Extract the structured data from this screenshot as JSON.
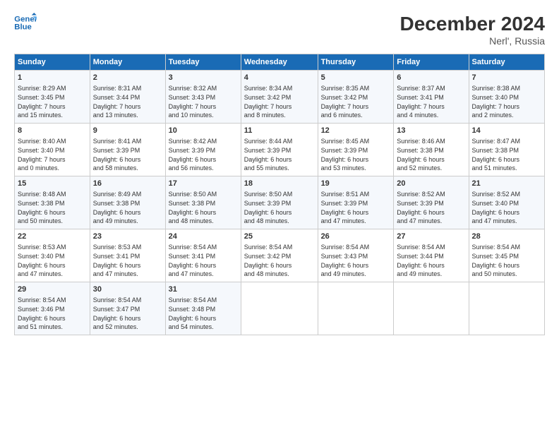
{
  "header": {
    "title": "December 2024",
    "subtitle": "Nerl', Russia",
    "logo_line1": "General",
    "logo_line2": "Blue"
  },
  "days_of_week": [
    "Sunday",
    "Monday",
    "Tuesday",
    "Wednesday",
    "Thursday",
    "Friday",
    "Saturday"
  ],
  "weeks": [
    [
      {
        "day": 1,
        "lines": [
          "Sunrise: 8:29 AM",
          "Sunset: 3:45 PM",
          "Daylight: 7 hours",
          "and 15 minutes."
        ]
      },
      {
        "day": 2,
        "lines": [
          "Sunrise: 8:31 AM",
          "Sunset: 3:44 PM",
          "Daylight: 7 hours",
          "and 13 minutes."
        ]
      },
      {
        "day": 3,
        "lines": [
          "Sunrise: 8:32 AM",
          "Sunset: 3:43 PM",
          "Daylight: 7 hours",
          "and 10 minutes."
        ]
      },
      {
        "day": 4,
        "lines": [
          "Sunrise: 8:34 AM",
          "Sunset: 3:42 PM",
          "Daylight: 7 hours",
          "and 8 minutes."
        ]
      },
      {
        "day": 5,
        "lines": [
          "Sunrise: 8:35 AM",
          "Sunset: 3:42 PM",
          "Daylight: 7 hours",
          "and 6 minutes."
        ]
      },
      {
        "day": 6,
        "lines": [
          "Sunrise: 8:37 AM",
          "Sunset: 3:41 PM",
          "Daylight: 7 hours",
          "and 4 minutes."
        ]
      },
      {
        "day": 7,
        "lines": [
          "Sunrise: 8:38 AM",
          "Sunset: 3:40 PM",
          "Daylight: 7 hours",
          "and 2 minutes."
        ]
      }
    ],
    [
      {
        "day": 8,
        "lines": [
          "Sunrise: 8:40 AM",
          "Sunset: 3:40 PM",
          "Daylight: 7 hours",
          "and 0 minutes."
        ]
      },
      {
        "day": 9,
        "lines": [
          "Sunrise: 8:41 AM",
          "Sunset: 3:39 PM",
          "Daylight: 6 hours",
          "and 58 minutes."
        ]
      },
      {
        "day": 10,
        "lines": [
          "Sunrise: 8:42 AM",
          "Sunset: 3:39 PM",
          "Daylight: 6 hours",
          "and 56 minutes."
        ]
      },
      {
        "day": 11,
        "lines": [
          "Sunrise: 8:44 AM",
          "Sunset: 3:39 PM",
          "Daylight: 6 hours",
          "and 55 minutes."
        ]
      },
      {
        "day": 12,
        "lines": [
          "Sunrise: 8:45 AM",
          "Sunset: 3:39 PM",
          "Daylight: 6 hours",
          "and 53 minutes."
        ]
      },
      {
        "day": 13,
        "lines": [
          "Sunrise: 8:46 AM",
          "Sunset: 3:38 PM",
          "Daylight: 6 hours",
          "and 52 minutes."
        ]
      },
      {
        "day": 14,
        "lines": [
          "Sunrise: 8:47 AM",
          "Sunset: 3:38 PM",
          "Daylight: 6 hours",
          "and 51 minutes."
        ]
      }
    ],
    [
      {
        "day": 15,
        "lines": [
          "Sunrise: 8:48 AM",
          "Sunset: 3:38 PM",
          "Daylight: 6 hours",
          "and 50 minutes."
        ]
      },
      {
        "day": 16,
        "lines": [
          "Sunrise: 8:49 AM",
          "Sunset: 3:38 PM",
          "Daylight: 6 hours",
          "and 49 minutes."
        ]
      },
      {
        "day": 17,
        "lines": [
          "Sunrise: 8:50 AM",
          "Sunset: 3:38 PM",
          "Daylight: 6 hours",
          "and 48 minutes."
        ]
      },
      {
        "day": 18,
        "lines": [
          "Sunrise: 8:50 AM",
          "Sunset: 3:39 PM",
          "Daylight: 6 hours",
          "and 48 minutes."
        ]
      },
      {
        "day": 19,
        "lines": [
          "Sunrise: 8:51 AM",
          "Sunset: 3:39 PM",
          "Daylight: 6 hours",
          "and 47 minutes."
        ]
      },
      {
        "day": 20,
        "lines": [
          "Sunrise: 8:52 AM",
          "Sunset: 3:39 PM",
          "Daylight: 6 hours",
          "and 47 minutes."
        ]
      },
      {
        "day": 21,
        "lines": [
          "Sunrise: 8:52 AM",
          "Sunset: 3:40 PM",
          "Daylight: 6 hours",
          "and 47 minutes."
        ]
      }
    ],
    [
      {
        "day": 22,
        "lines": [
          "Sunrise: 8:53 AM",
          "Sunset: 3:40 PM",
          "Daylight: 6 hours",
          "and 47 minutes."
        ]
      },
      {
        "day": 23,
        "lines": [
          "Sunrise: 8:53 AM",
          "Sunset: 3:41 PM",
          "Daylight: 6 hours",
          "and 47 minutes."
        ]
      },
      {
        "day": 24,
        "lines": [
          "Sunrise: 8:54 AM",
          "Sunset: 3:41 PM",
          "Daylight: 6 hours",
          "and 47 minutes."
        ]
      },
      {
        "day": 25,
        "lines": [
          "Sunrise: 8:54 AM",
          "Sunset: 3:42 PM",
          "Daylight: 6 hours",
          "and 48 minutes."
        ]
      },
      {
        "day": 26,
        "lines": [
          "Sunrise: 8:54 AM",
          "Sunset: 3:43 PM",
          "Daylight: 6 hours",
          "and 49 minutes."
        ]
      },
      {
        "day": 27,
        "lines": [
          "Sunrise: 8:54 AM",
          "Sunset: 3:44 PM",
          "Daylight: 6 hours",
          "and 49 minutes."
        ]
      },
      {
        "day": 28,
        "lines": [
          "Sunrise: 8:54 AM",
          "Sunset: 3:45 PM",
          "Daylight: 6 hours",
          "and 50 minutes."
        ]
      }
    ],
    [
      {
        "day": 29,
        "lines": [
          "Sunrise: 8:54 AM",
          "Sunset: 3:46 PM",
          "Daylight: 6 hours",
          "and 51 minutes."
        ]
      },
      {
        "day": 30,
        "lines": [
          "Sunrise: 8:54 AM",
          "Sunset: 3:47 PM",
          "Daylight: 6 hours",
          "and 52 minutes."
        ]
      },
      {
        "day": 31,
        "lines": [
          "Sunrise: 8:54 AM",
          "Sunset: 3:48 PM",
          "Daylight: 6 hours",
          "and 54 minutes."
        ]
      },
      null,
      null,
      null,
      null
    ]
  ]
}
